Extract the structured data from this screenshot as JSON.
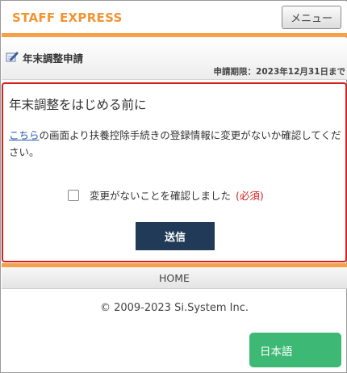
{
  "header": {
    "brand": "STAFF EXPRESS",
    "menu_label": "メニュー"
  },
  "titlebar": {
    "title": "年末調整申請",
    "deadline": "申請期限：2023年12月31日まで",
    "icon": "pencil-note-icon"
  },
  "notice": {
    "heading": "年末調整をはじめる前に",
    "link_text": "こちら",
    "body_text": "の画面より扶養控除手続きの登録情報に変更がないか確認してください。",
    "confirm_label": "変更がないことを確認しました",
    "required_label": "(必須)",
    "submit_label": "送信"
  },
  "footer": {
    "home_label": "HOME",
    "copyright": "© 2009-2023 Si.System Inc.",
    "language_button": "日本語"
  },
  "colors": {
    "brand": "#f29433",
    "accent_bar": "#f6a048",
    "alert_border": "#d52020",
    "submit_bg": "#213a57",
    "language_bg": "#3db875",
    "link": "#2a5db0"
  }
}
